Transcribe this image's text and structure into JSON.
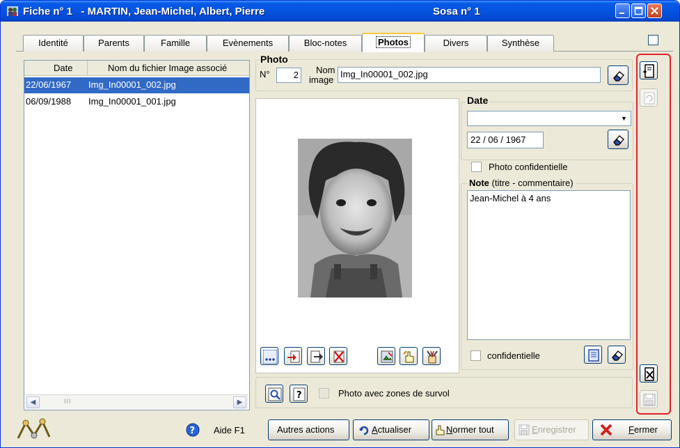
{
  "window": {
    "title": "Fiche n° 1   - MARTIN, Jean-Michel, Albert, Pierre",
    "sosa": "Sosa n° 1"
  },
  "tabs": [
    {
      "label": "Identité"
    },
    {
      "label": "Parents"
    },
    {
      "label": "Famille"
    },
    {
      "label": "Evènements"
    },
    {
      "label": "Bloc-notes"
    },
    {
      "label": "Photos"
    },
    {
      "label": "Divers"
    },
    {
      "label": "Synthèse"
    }
  ],
  "active_tab": "Photos",
  "list": {
    "headers": {
      "date": "Date",
      "filename": "Nom du fichier Image associé"
    },
    "rows": [
      {
        "date": "22/06/1967",
        "filename": "Img_In00001_002.jpg",
        "selected": true
      },
      {
        "date": "06/09/1988",
        "filename": "Img_In00001_001.jpg",
        "selected": false
      }
    ],
    "scroll_grip": "III"
  },
  "photo": {
    "group_label": "Photo",
    "number_label": "N°",
    "number_value": "2",
    "name_label_1": "Nom",
    "name_label_2": "image",
    "name_value": "Img_In00001_002.jpg"
  },
  "date": {
    "group_label": "Date",
    "dropdown_value": "",
    "value": "22 / 06 / 1967"
  },
  "confidential_photo_label": "Photo confidentielle",
  "note": {
    "label_bold": "Note",
    "label_rest": "(titre - commentaire)",
    "value": "Jean-Michel à 4 ans",
    "confidential_label": "confidentielle"
  },
  "hover_zones_label": "Photo avec zones de survol",
  "bottom": {
    "help": "Aide  F1",
    "other_actions": "Autres actions",
    "refresh_prefix": "",
    "refresh_u": "A",
    "refresh_rest": "ctualiser",
    "normalize_u": "N",
    "normalize_rest": "ormer tout",
    "save_u": "E",
    "save_rest": "nregistrer",
    "close_u": "F",
    "close_rest": "ermer"
  },
  "colors": {
    "titlebar": "#0554e0",
    "selection": "#316ac5",
    "highlight_border": "#e2222a",
    "active_tab_accent": "#ffc83c"
  }
}
